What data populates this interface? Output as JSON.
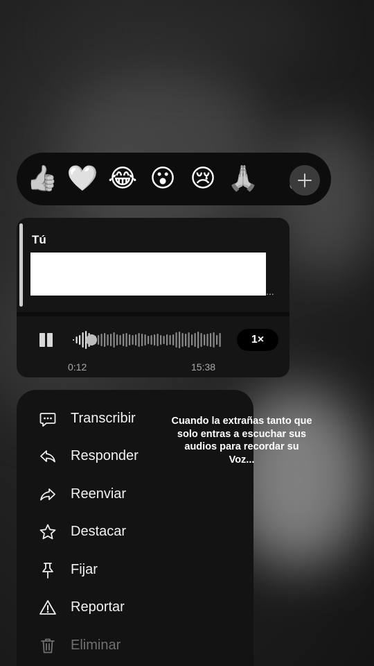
{
  "reactions": {
    "emojis": [
      {
        "icon": "thumbs-up-icon",
        "glyph": "👍"
      },
      {
        "icon": "heart-icon",
        "glyph": "🤍"
      },
      {
        "icon": "tears-of-joy-icon",
        "glyph": "😂"
      },
      {
        "icon": "surprised-face-icon",
        "glyph": "😮"
      },
      {
        "icon": "crying-face-icon",
        "glyph": "😢"
      },
      {
        "icon": "folded-hands-icon",
        "glyph": "🙏"
      },
      {
        "icon": "see-no-evil-monkey-icon",
        "glyph": "🙈"
      }
    ],
    "more_icon": "plus-icon"
  },
  "message": {
    "reply_author": "Tú",
    "reply_more": "...",
    "audio": {
      "elapsed": "0:12",
      "duration": "15:38",
      "speed": "1×",
      "progress": 0.05
    }
  },
  "menu": {
    "items": [
      {
        "label": "Transcribir",
        "icon": "transcribe-icon"
      },
      {
        "label": "Responder",
        "icon": "reply-icon"
      },
      {
        "label": "Reenviar",
        "icon": "forward-icon"
      },
      {
        "label": "Destacar",
        "icon": "star-icon"
      },
      {
        "label": "Fijar",
        "icon": "pin-icon"
      },
      {
        "label": "Reportar",
        "icon": "warning-icon"
      },
      {
        "label": "Eliminar",
        "icon": "trash-icon"
      }
    ]
  },
  "caption": "Cuando la extrañas tanto que solo entras a escuchar sus audios para recordar su Voz..."
}
